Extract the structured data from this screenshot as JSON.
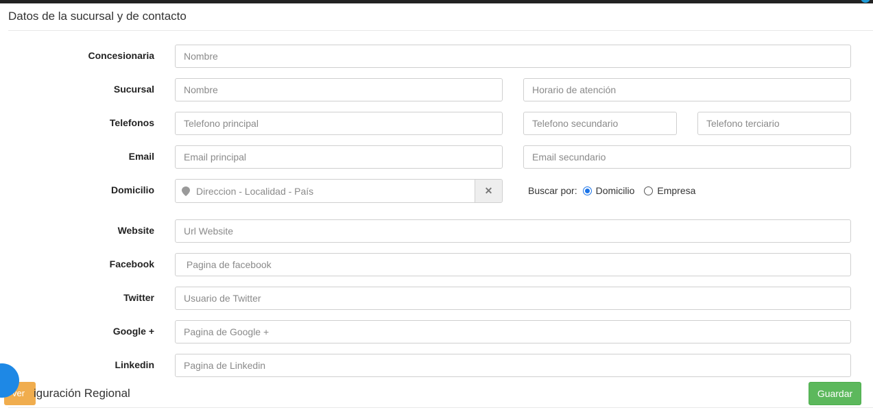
{
  "section": {
    "title": "Datos de la sucursal y de contacto"
  },
  "fields": {
    "concesionaria": {
      "label": "Concesionaria",
      "placeholder": "Nombre"
    },
    "sucursal": {
      "label": "Sucursal",
      "name_placeholder": "Nombre",
      "hours_placeholder": "Horario de atención"
    },
    "telefonos": {
      "label": "Telefonos",
      "primary_placeholder": "Telefono principal",
      "secondary_placeholder": "Telefono secundario",
      "tertiary_placeholder": "Telefono terciario"
    },
    "email": {
      "label": "Email",
      "primary_placeholder": "Email principal",
      "secondary_placeholder": "Email secundario"
    },
    "domicilio": {
      "label": "Domicilio",
      "placeholder": "Direccion - Localidad - País",
      "clear_glyph": "✕"
    },
    "website": {
      "label": "Website",
      "placeholder": "Url Website"
    },
    "facebook": {
      "label": "Facebook",
      "placeholder": " Pagina de facebook"
    },
    "twitter": {
      "label": "Twitter",
      "placeholder": "Usuario de Twitter"
    },
    "google": {
      "label": "Google +",
      "placeholder": "Pagina de Google +"
    },
    "linkedin": {
      "label": "Linkedin",
      "placeholder": "Pagina de Linkedin"
    }
  },
  "search_by": {
    "label": "Buscar por:",
    "options": [
      {
        "label": "Domicilio",
        "selected": true
      },
      {
        "label": "Empresa",
        "selected": false
      }
    ]
  },
  "footer": {
    "partial_button_label": "ver",
    "next_section_title": "iguración Regional",
    "save_label": "Guardar"
  },
  "colors": {
    "save_button": "#5cb85c",
    "partial_button": "#f0ad4e",
    "chat_bubble": "#1e88e5",
    "radio_selected": "#1a73e8"
  },
  "icons": [
    "map-pin-icon",
    "clear-icon",
    "chat-icon"
  ]
}
